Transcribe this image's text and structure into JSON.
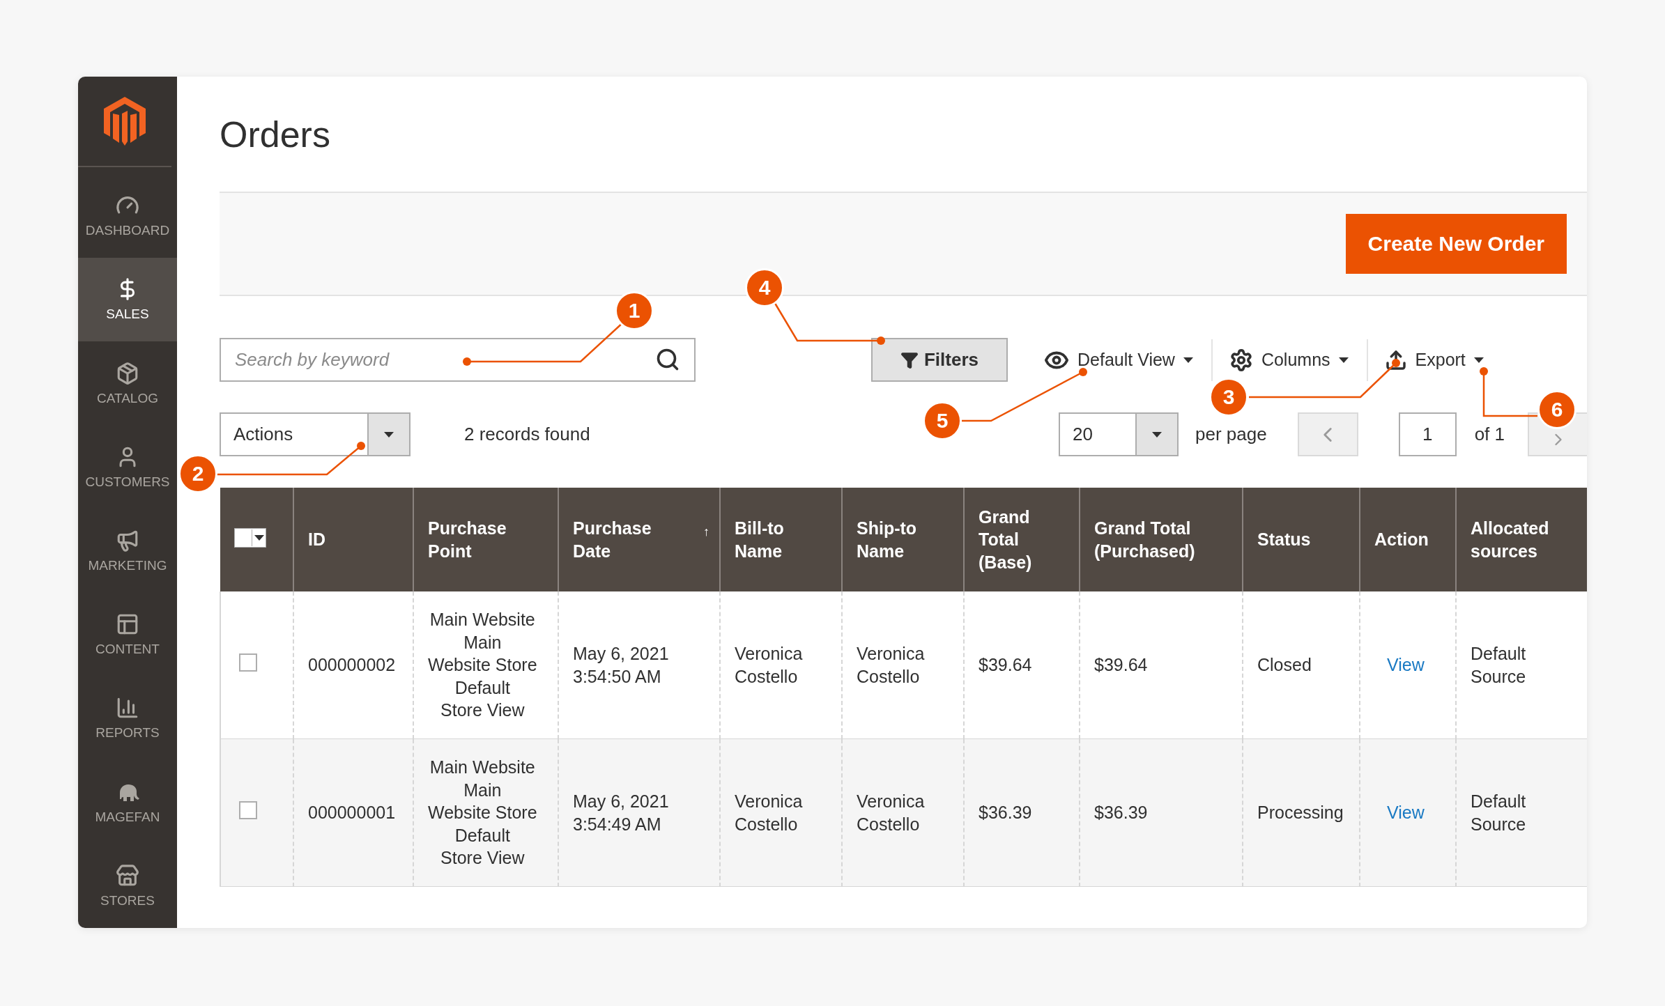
{
  "sidebar": {
    "items": [
      {
        "kind": "dashboard",
        "label": "DASHBOARD",
        "selected": false
      },
      {
        "kind": "sales",
        "label": "SALES",
        "selected": true
      },
      {
        "kind": "catalog",
        "label": "CATALOG",
        "selected": false
      },
      {
        "kind": "customers",
        "label": "CUSTOMERS",
        "selected": false
      },
      {
        "kind": "marketing",
        "label": "MARKETING",
        "selected": false
      },
      {
        "kind": "content",
        "label": "CONTENT",
        "selected": false
      },
      {
        "kind": "reports",
        "label": "REPORTS",
        "selected": false
      },
      {
        "kind": "magefan",
        "label": "MAGEFAN",
        "selected": false
      },
      {
        "kind": "stores",
        "label": "STORES",
        "selected": false
      }
    ]
  },
  "page_title": "Orders",
  "create_button": "Create New Order",
  "search": {
    "placeholder": "Search by keyword"
  },
  "filters_button": "Filters",
  "view_control": "Default View",
  "columns_control": "Columns",
  "export_control": "Export",
  "actions_select": "Actions",
  "records_found": "2 records found",
  "per_page": {
    "value": "20",
    "label": "per page"
  },
  "pagination": {
    "page": "1",
    "of": "of 1"
  },
  "table": {
    "select_all": {
      "checked": false
    },
    "columns": [
      {
        "label": "ID"
      },
      {
        "label": "Purchase Point"
      },
      {
        "label": "Purchase Date",
        "sort_mark": "↑"
      },
      {
        "label": "Bill-to Name"
      },
      {
        "label": "Ship-to Name"
      },
      {
        "label": "Grand Total (Base)"
      },
      {
        "label": "Grand Total (Purchased)"
      },
      {
        "label": "Status"
      },
      {
        "label": "Action"
      },
      {
        "label": "Allocated sources"
      }
    ],
    "rows": [
      {
        "checked": false,
        "id": "000000002",
        "purchase_point": [
          "Main Website",
          "Main",
          "Website Store",
          "Default",
          "Store View"
        ],
        "purchase_date": "May 6, 2021 3:54:50 AM",
        "bill_to": "Veronica Costello",
        "ship_to": "Veronica Costello",
        "grand_total_base": "$39.64",
        "grand_total_purchased": "$39.64",
        "status": "Closed",
        "action": "View",
        "allocated_sources": "Default Source"
      },
      {
        "checked": false,
        "id": "000000001",
        "purchase_point": [
          "Main Website",
          "Main",
          "Website Store",
          "Default",
          "Store View"
        ],
        "purchase_date": "May 6, 2021 3:54:49 AM",
        "bill_to": "Veronica Costello",
        "ship_to": "Veronica Costello",
        "grand_total_base": "$36.39",
        "grand_total_purchased": "$36.39",
        "status": "Processing",
        "action": "View",
        "allocated_sources": "Default Source"
      }
    ]
  },
  "callouts": [
    {
      "number": "1"
    },
    {
      "number": "2"
    },
    {
      "number": "3"
    },
    {
      "number": "4"
    },
    {
      "number": "5"
    },
    {
      "number": "6"
    }
  ]
}
